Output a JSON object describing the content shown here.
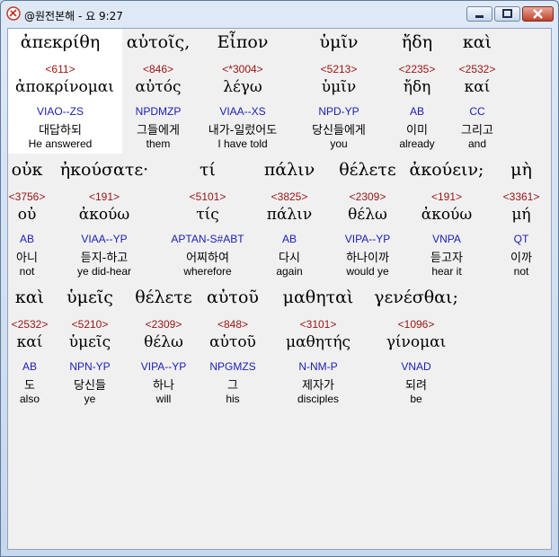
{
  "window": {
    "title": "@원전본해 - 요 9:27",
    "controls": [
      "minimize-icon",
      "maximize-icon",
      "close-icon"
    ]
  },
  "colors": {
    "strongs": "#9a1212",
    "morph": "#1c1cb4",
    "text": "#000000",
    "highlight": "#ffffff"
  },
  "rows": [
    {
      "words": [
        {
          "greek": "ἀπεκρίθη",
          "strong": "<611>",
          "lemma": "ἀποκρίνομαι",
          "morph": "VIAO--ZS",
          "korean": "대답하되",
          "english": "He answered"
        },
        {
          "greek": "αὐτοῖς,",
          "strong": "<846>",
          "lemma": "αὐτός",
          "morph": "NPDMZP",
          "korean": "그들에게",
          "english": "them"
        },
        {
          "greek": "Εἶπον",
          "strong": "<*3004>",
          "lemma": "λέγω",
          "morph": "VIAA--XS",
          "korean": "내가-일렀어도",
          "english": "I have told"
        },
        {
          "greek": "ὑμῖν",
          "strong": "<5213>",
          "lemma": "ὑμῖν",
          "morph": "NPD-YP",
          "korean": "당신들에게",
          "english": "you"
        },
        {
          "greek": "ἤδη",
          "strong": "<2235>",
          "lemma": "ἤδη",
          "morph": "AB",
          "korean": "이미",
          "english": "already"
        },
        {
          "greek": "καὶ",
          "strong": "<2532>",
          "lemma": "καί",
          "morph": "CC",
          "korean": "그리고",
          "english": "and"
        }
      ]
    },
    {
      "words": [
        {
          "greek": "οὐκ",
          "strong": "<3756>",
          "lemma": "οὐ",
          "morph": "AB",
          "korean": "아니",
          "english": "not"
        },
        {
          "greek": "ἠκούσατε·",
          "strong": "<191>",
          "lemma": "ἀκούω",
          "morph": "VIAA--YP",
          "korean": "듣지-하고",
          "english": "ye did-hear"
        },
        {
          "greek": "τί",
          "strong": "<5101>",
          "lemma": "τίς",
          "morph": "APTAN-S#ABT",
          "korean": "어찌하여",
          "english": "wherefore"
        },
        {
          "greek": "πάλιν",
          "strong": "<3825>",
          "lemma": "πάλιν",
          "morph": "AB",
          "korean": "다시",
          "english": "again"
        },
        {
          "greek": "θέλετε",
          "strong": "<2309>",
          "lemma": "θέλω",
          "morph": "VIPA--YP",
          "korean": "하나이까",
          "english": "would ye"
        },
        {
          "greek": "ἀκούειν;",
          "strong": "<191>",
          "lemma": "ἀκούω",
          "morph": "VNPA",
          "korean": "듣고자",
          "english": "hear it"
        },
        {
          "greek": "μὴ",
          "strong": "<3361>",
          "lemma": "μή",
          "morph": "QT",
          "korean": "이까",
          "english": "not"
        }
      ]
    },
    {
      "words": [
        {
          "greek": "καὶ",
          "strong": "<2532>",
          "lemma": "καί",
          "morph": "AB",
          "korean": "도",
          "english": "also"
        },
        {
          "greek": "ὑμεῖς",
          "strong": "<5210>",
          "lemma": "ὑμεῖς",
          "morph": "NPN-YP",
          "korean": "당신들",
          "english": "ye"
        },
        {
          "greek": "θέλετε",
          "strong": "<2309>",
          "lemma": "θέλω",
          "morph": "VIPA--YP",
          "korean": "하나",
          "english": "will"
        },
        {
          "greek": "αὐτοῦ",
          "strong": "<848>",
          "lemma": "αὐτοῦ",
          "morph": "NPGMZS",
          "korean": "그",
          "english": "his"
        },
        {
          "greek": "μαθηταὶ",
          "strong": "<3101>",
          "lemma": "μαθητής",
          "morph": "N-NM-P",
          "korean": "제자가",
          "english": "disciples"
        },
        {
          "greek": "γενέσθαι;",
          "strong": "<1096>",
          "lemma": "γίνομαι",
          "morph": "VNAD",
          "korean": "되려",
          "english": "be"
        }
      ]
    }
  ]
}
